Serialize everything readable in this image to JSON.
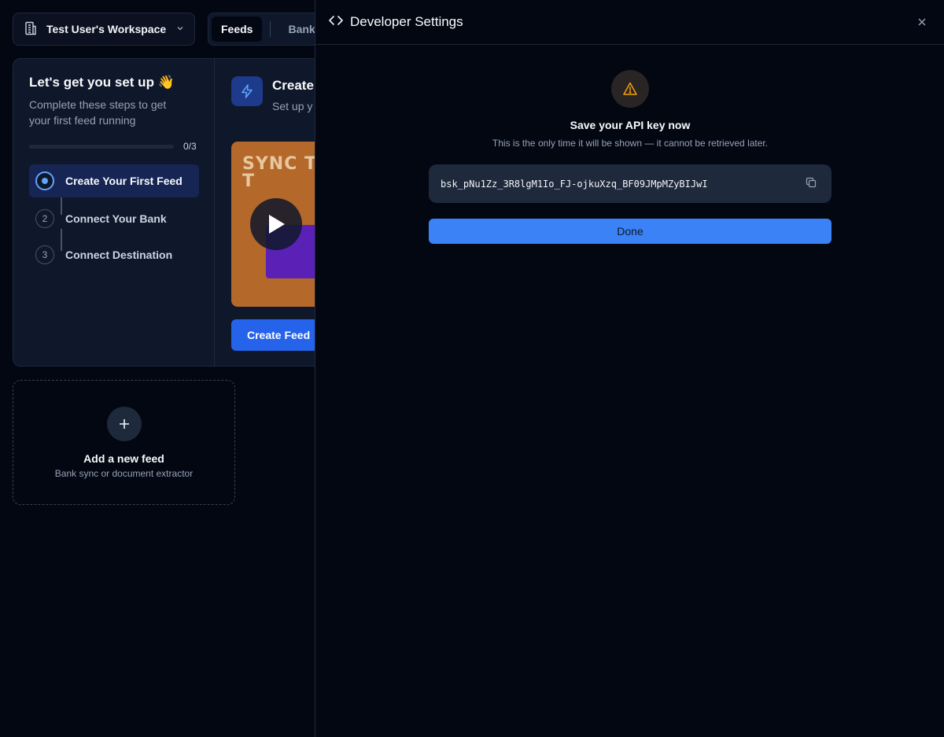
{
  "header": {
    "workspace_name": "Test User's Workspace",
    "tabs": [
      {
        "label": "Feeds",
        "active": true
      },
      {
        "label": "Banks",
        "active": false
      }
    ]
  },
  "onboarding": {
    "title": "Let's get you set up 👋",
    "subtitle": "Complete these steps to get your first feed running",
    "progress_text": "0/3",
    "progress_fraction": 0,
    "steps": [
      {
        "number": "",
        "label": "Create Your First Feed",
        "active": true
      },
      {
        "number": "2",
        "label": "Connect Your Bank",
        "active": false
      },
      {
        "number": "3",
        "label": "Connect Destination",
        "active": false
      }
    ],
    "detail": {
      "title": "Create",
      "subtitle": "Set up y financial",
      "video_text": "SYNC TRANSA T",
      "button_label": "Create Feed"
    }
  },
  "add_feed": {
    "title": "Add a new feed",
    "subtitle": "Bank sync or document extractor"
  },
  "panel": {
    "title": "Developer Settings",
    "warning_title": "Save your API key now",
    "warning_subtitle": "This is the only time it will be shown — it cannot be retrieved later.",
    "api_key": "bsk_pNu1Zz_3R8lgM1Io_FJ-ojkuXzq_BF09JMpMZyBIJwI",
    "done_label": "Done"
  },
  "colors": {
    "background": "#030712",
    "accent": "#3b82f6",
    "warning": "#f59e0b"
  }
}
